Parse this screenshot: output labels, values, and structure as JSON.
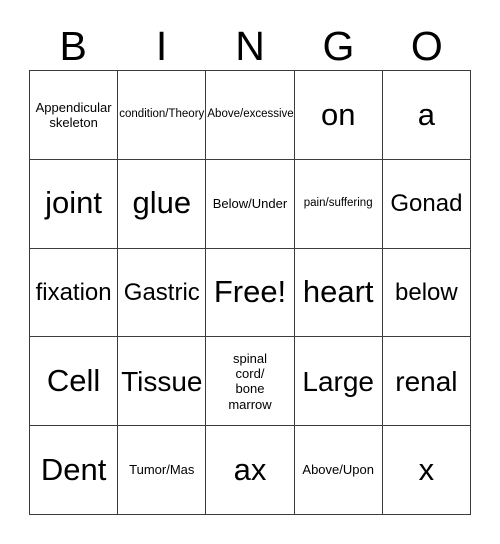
{
  "card": {
    "header_letters": [
      "B",
      "I",
      "N",
      "G",
      "O"
    ],
    "columns": 5,
    "rows": 5,
    "border_color": "#3c3c3c",
    "background_color": "#ffffff",
    "text_color": "#000000",
    "free_space": {
      "label": "Free!",
      "row": 3,
      "column": 3
    },
    "cells": [
      [
        {
          "text": "Appendicular\nskeleton",
          "size": "sm"
        },
        {
          "text": "condition/Theory",
          "size": "xs"
        },
        {
          "text": "Above/excessive",
          "size": "xs"
        },
        {
          "text": "on",
          "size": "xxl"
        },
        {
          "text": "a",
          "size": "xxl"
        }
      ],
      [
        {
          "text": "joint",
          "size": "xxl"
        },
        {
          "text": "glue",
          "size": "xxl"
        },
        {
          "text": "Below/Under",
          "size": "sm"
        },
        {
          "text": "pain/suffering",
          "size": "xs"
        },
        {
          "text": "Gonad",
          "size": "lg"
        }
      ],
      [
        {
          "text": "fixation",
          "size": "lg"
        },
        {
          "text": "Gastric",
          "size": "lg"
        },
        {
          "text": "Free!",
          "size": "xxl"
        },
        {
          "text": "heart",
          "size": "xxl"
        },
        {
          "text": "below",
          "size": "lg"
        }
      ],
      [
        {
          "text": "Cell",
          "size": "xxl"
        },
        {
          "text": "Tissue",
          "size": "xl"
        },
        {
          "text": "spinal\ncord/\nbone\nmarrow",
          "size": "sm"
        },
        {
          "text": "Large",
          "size": "xl"
        },
        {
          "text": "renal",
          "size": "xl"
        }
      ],
      [
        {
          "text": "Dent",
          "size": "xxl"
        },
        {
          "text": "Tumor/Mas",
          "size": "sm"
        },
        {
          "text": "ax",
          "size": "xxl"
        },
        {
          "text": "Above/Upon",
          "size": "sm"
        },
        {
          "text": "x",
          "size": "xxl"
        }
      ]
    ]
  }
}
